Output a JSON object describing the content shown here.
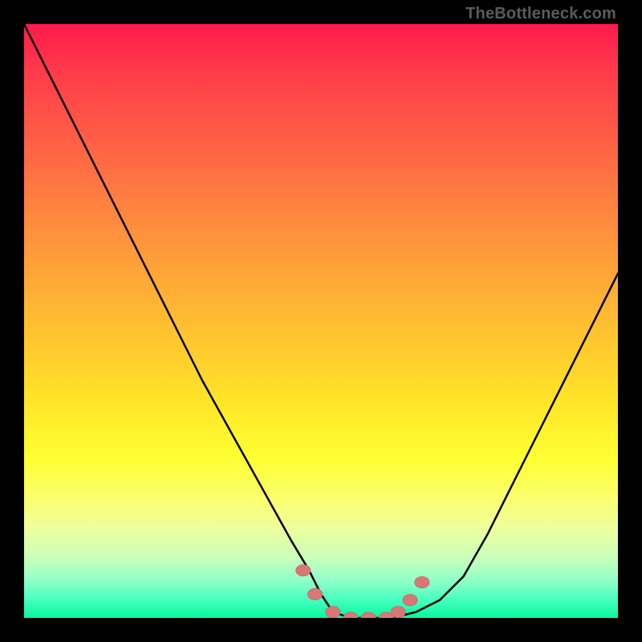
{
  "attribution": "TheBottleneck.com",
  "colors": {
    "frame": "#000000",
    "gradient_stops": [
      "#ff1a4d",
      "#ff3b4a",
      "#ff5a47",
      "#ff8a3e",
      "#ffb733",
      "#ffe328",
      "#ffff32",
      "#fbff6e",
      "#edff9e",
      "#c8ffbc",
      "#8affc8",
      "#44ffbf",
      "#08f79c"
    ],
    "curve_stroke": "#000000",
    "marker_fill": "#d97777",
    "marker_stroke": "#c96b6b"
  },
  "chart_data": {
    "type": "line",
    "title": "",
    "xlabel": "",
    "ylabel": "",
    "xlim": [
      0,
      100
    ],
    "ylim": [
      0,
      100
    ],
    "grid": false,
    "legend": false,
    "series": [
      {
        "name": "curve",
        "x": [
          0,
          3,
          6,
          10,
          15,
          20,
          25,
          30,
          35,
          40,
          45,
          48,
          50,
          52,
          55,
          58,
          62,
          66,
          70,
          74,
          78,
          82,
          86,
          90,
          95,
          100
        ],
        "y": [
          100,
          94,
          88,
          80,
          70,
          60,
          50,
          40,
          31,
          22,
          13,
          8,
          4,
          1,
          0,
          0,
          0,
          1,
          3,
          7,
          14,
          22,
          30,
          38,
          48,
          58
        ]
      }
    ],
    "markers": {
      "name": "highlighted-points",
      "x": [
        47,
        49,
        52,
        55,
        58,
        61,
        63,
        65,
        67
      ],
      "y": [
        8,
        4,
        1,
        0,
        0,
        0,
        1,
        3,
        6
      ]
    }
  }
}
